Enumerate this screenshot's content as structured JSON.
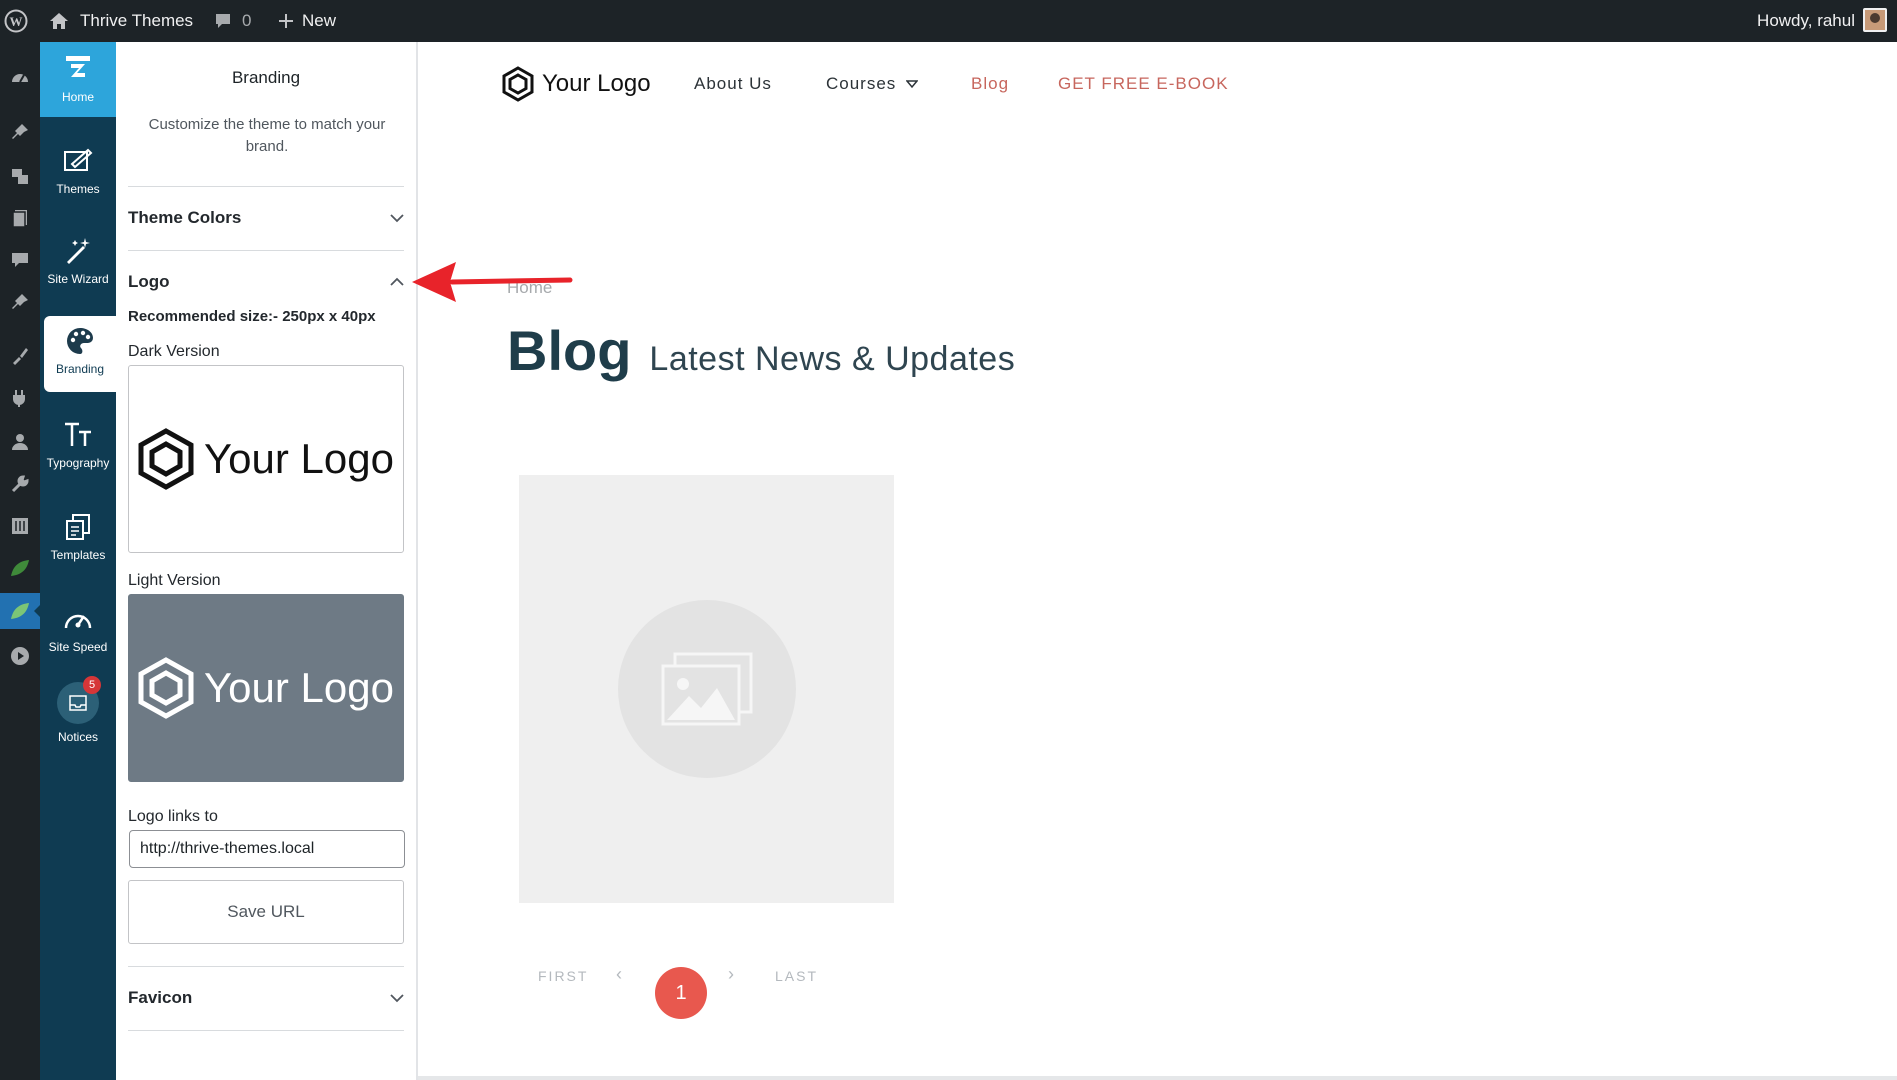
{
  "adminbar": {
    "site_name": "Thrive Themes",
    "comments_count": "0",
    "new_label": "New",
    "howdy": "Howdy, rahul"
  },
  "thrive_sidebar": {
    "items": [
      {
        "label": "Home",
        "icon": "thrive-home-icon"
      },
      {
        "label": "Themes",
        "icon": "themes-icon"
      },
      {
        "label": "Site Wizard",
        "icon": "magic-wand-icon"
      },
      {
        "label": "Branding",
        "icon": "palette-icon"
      },
      {
        "label": "Typography",
        "icon": "typography-icon"
      },
      {
        "label": "Templates",
        "icon": "templates-icon"
      },
      {
        "label": "Site Speed",
        "icon": "speedometer-icon"
      },
      {
        "label": "Notices",
        "icon": "inbox-icon",
        "badge": "5"
      }
    ]
  },
  "panel": {
    "title": "Branding",
    "description": "Customize the theme to match your brand.",
    "theme_colors": "Theme Colors",
    "logo_section": "Logo",
    "recommended": "Recommended size:- 250px x 40px",
    "dark_label": "Dark Version",
    "light_label": "Light Version",
    "logo_text": "Your Logo",
    "links_to_label": "Logo links to",
    "url_value": "http://thrive-themes.local",
    "save_url": "Save URL",
    "favicon": "Favicon"
  },
  "preview": {
    "logo_text": "Your Logo",
    "nav": {
      "about": "About Us",
      "courses": "Courses",
      "blog": "Blog",
      "ebook": "GET FREE E-BOOK"
    },
    "breadcrumb": "Home",
    "page_title": "Blog",
    "page_subtitle": "Latest News & Updates",
    "pagination": {
      "first": "FIRST",
      "prev": "‹",
      "current": "1",
      "next": "›",
      "last": "LAST"
    }
  },
  "colors": {
    "accent_red": "#e8584e",
    "thrive_navy": "#0f3b52",
    "thrive_blue": "#2da5db",
    "annotation_arrow": "#e8232a"
  }
}
